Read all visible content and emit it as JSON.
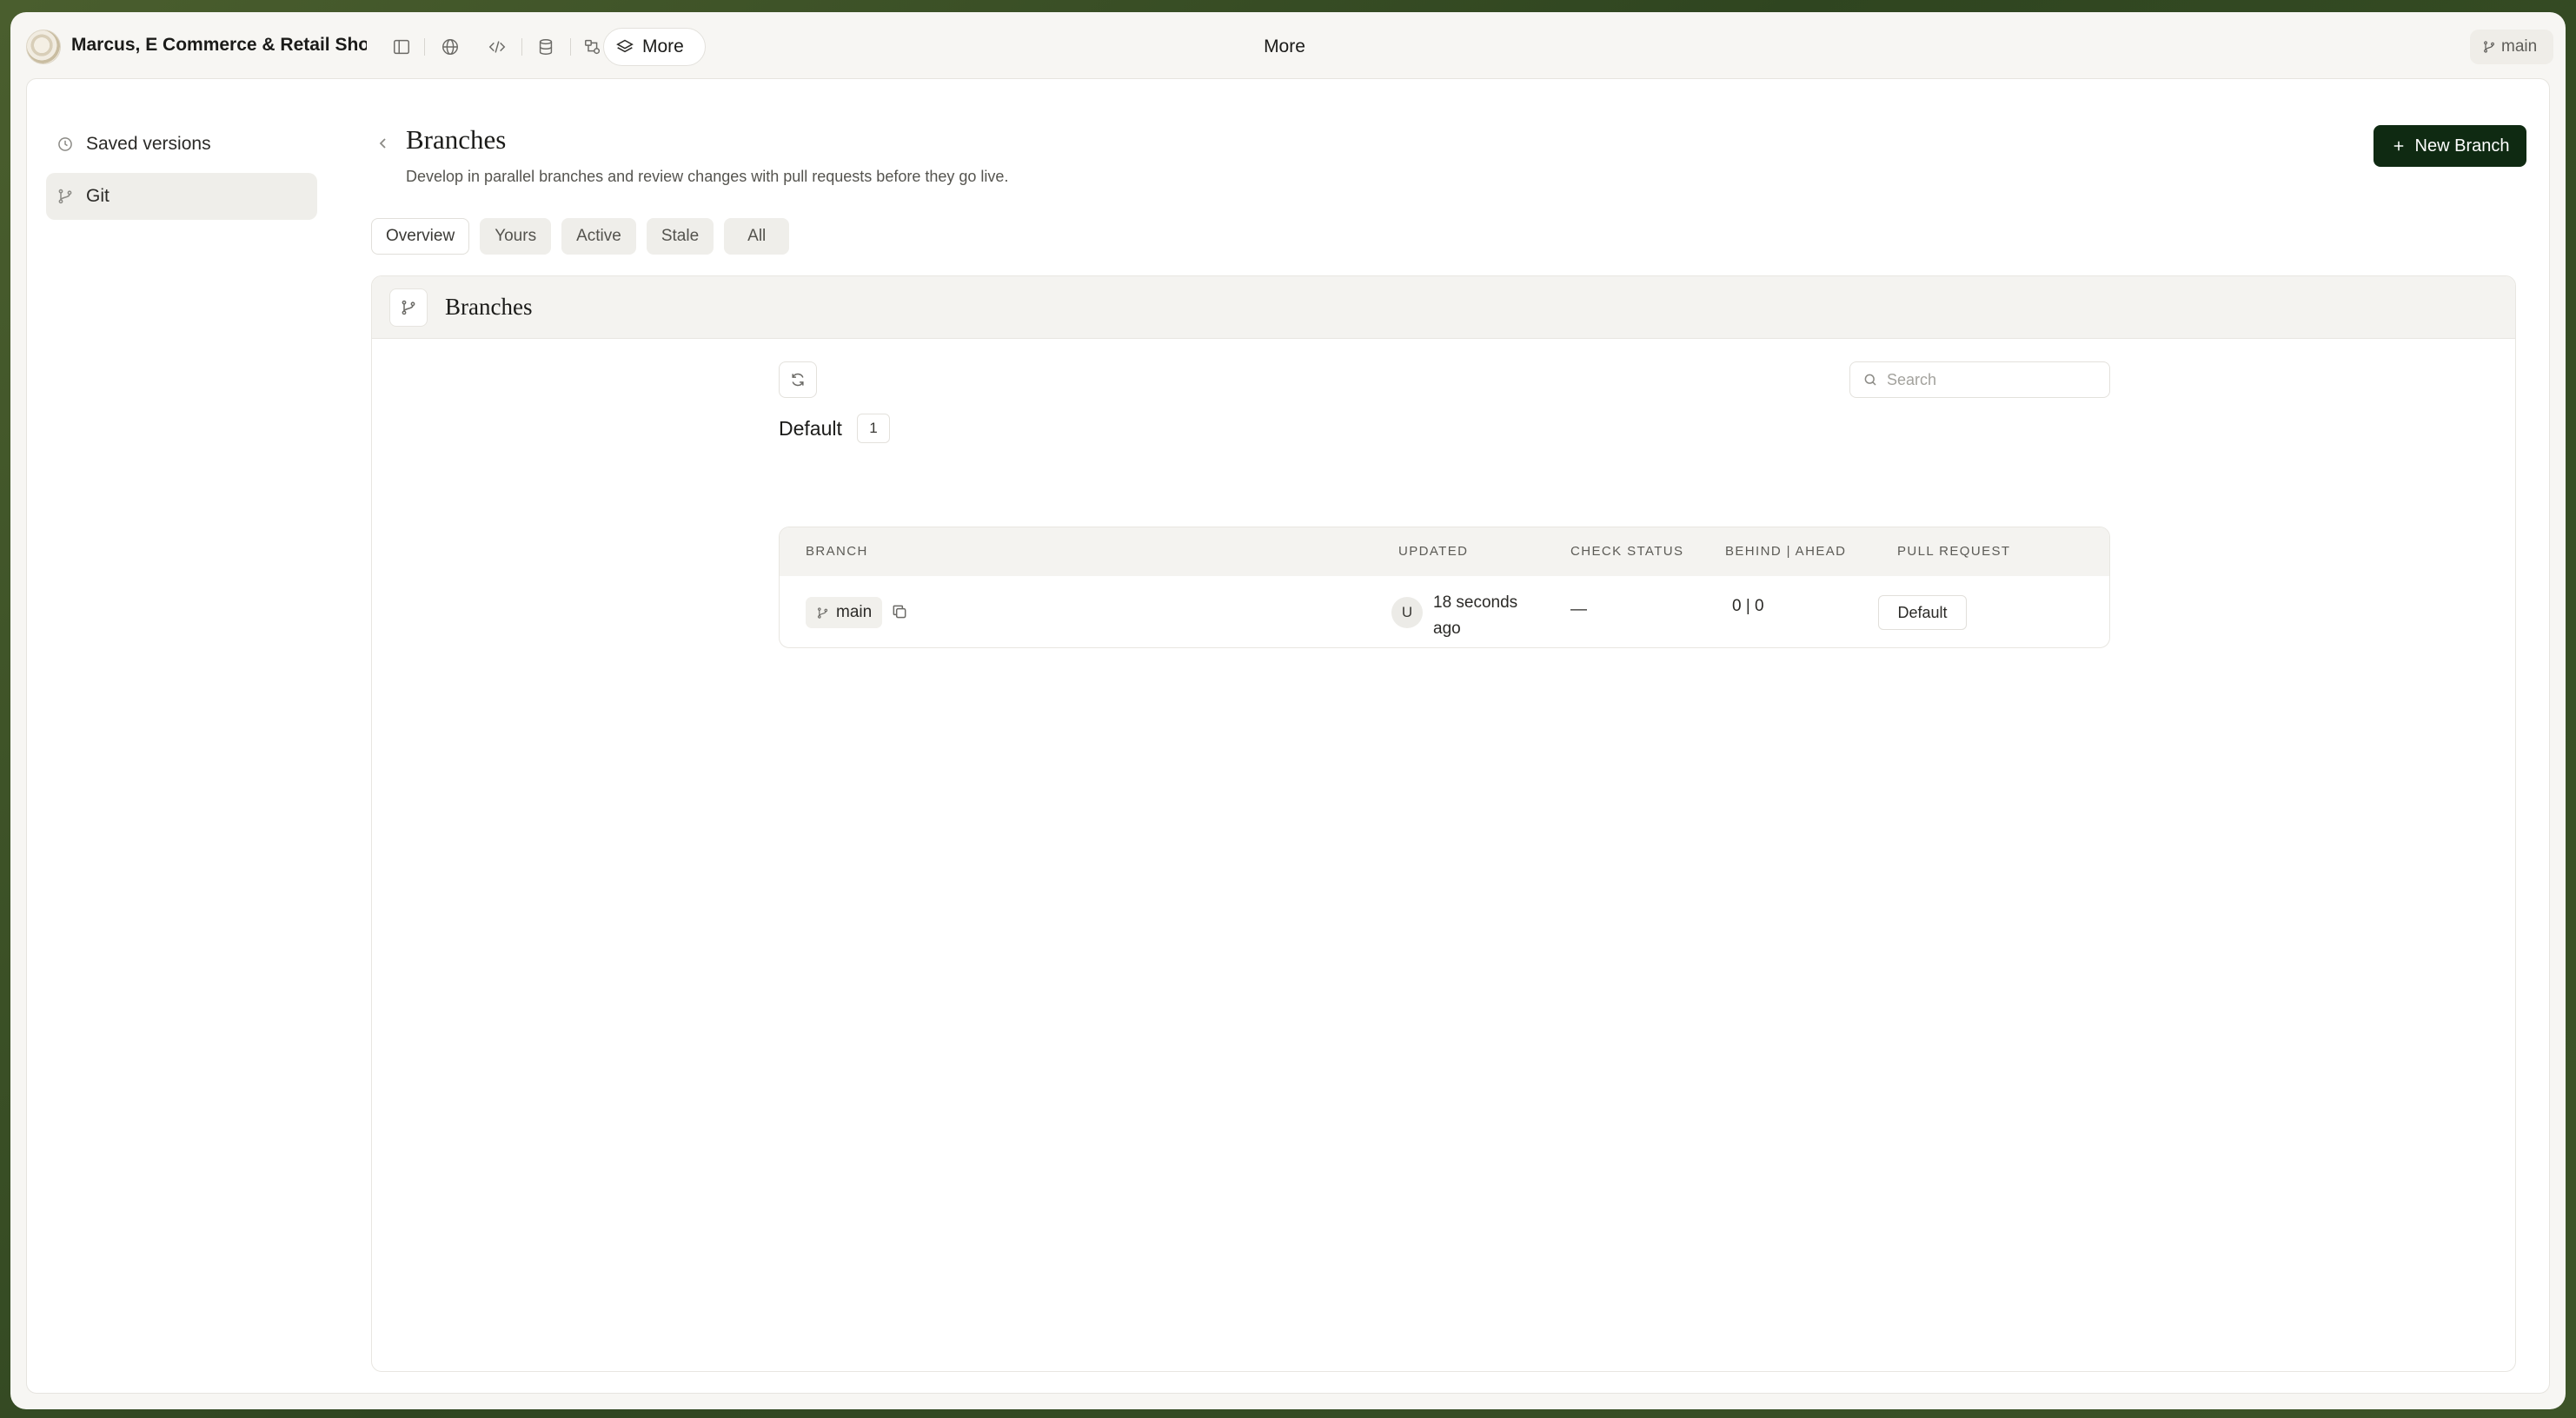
{
  "topbar": {
    "app_title": "Marcus, E Commerce & Retail Sho...",
    "more_label": "More",
    "center_title": "More",
    "branch": "main"
  },
  "sidebar": {
    "items": [
      {
        "label": "Saved versions",
        "icon": "history-icon"
      },
      {
        "label": "Git",
        "icon": "git-branch-icon",
        "active": true
      }
    ]
  },
  "page": {
    "title": "Branches",
    "description": "Develop in parallel branches and review changes with pull requests before they go live.",
    "new_branch_label": "New Branch"
  },
  "tabs": [
    {
      "label": "Overview",
      "active": true
    },
    {
      "label": "Yours"
    },
    {
      "label": "Active"
    },
    {
      "label": "Stale"
    },
    {
      "label": "All"
    }
  ],
  "card": {
    "title": "Branches",
    "search_placeholder": "Search",
    "group": {
      "label": "Default",
      "count": "1"
    }
  },
  "table": {
    "headers": [
      "BRANCH",
      "UPDATED",
      "CHECK STATUS",
      "BEHIND | AHEAD",
      "PULL REQUEST"
    ],
    "rows": [
      {
        "branch": "main",
        "avatar": "U",
        "updated": "18 seconds ago",
        "check_status": "—",
        "behind_ahead": "0 | 0",
        "pull_request": "Default"
      }
    ]
  },
  "colors": {
    "primary_button": "#0f2a12",
    "background": "#f7f6f3"
  }
}
